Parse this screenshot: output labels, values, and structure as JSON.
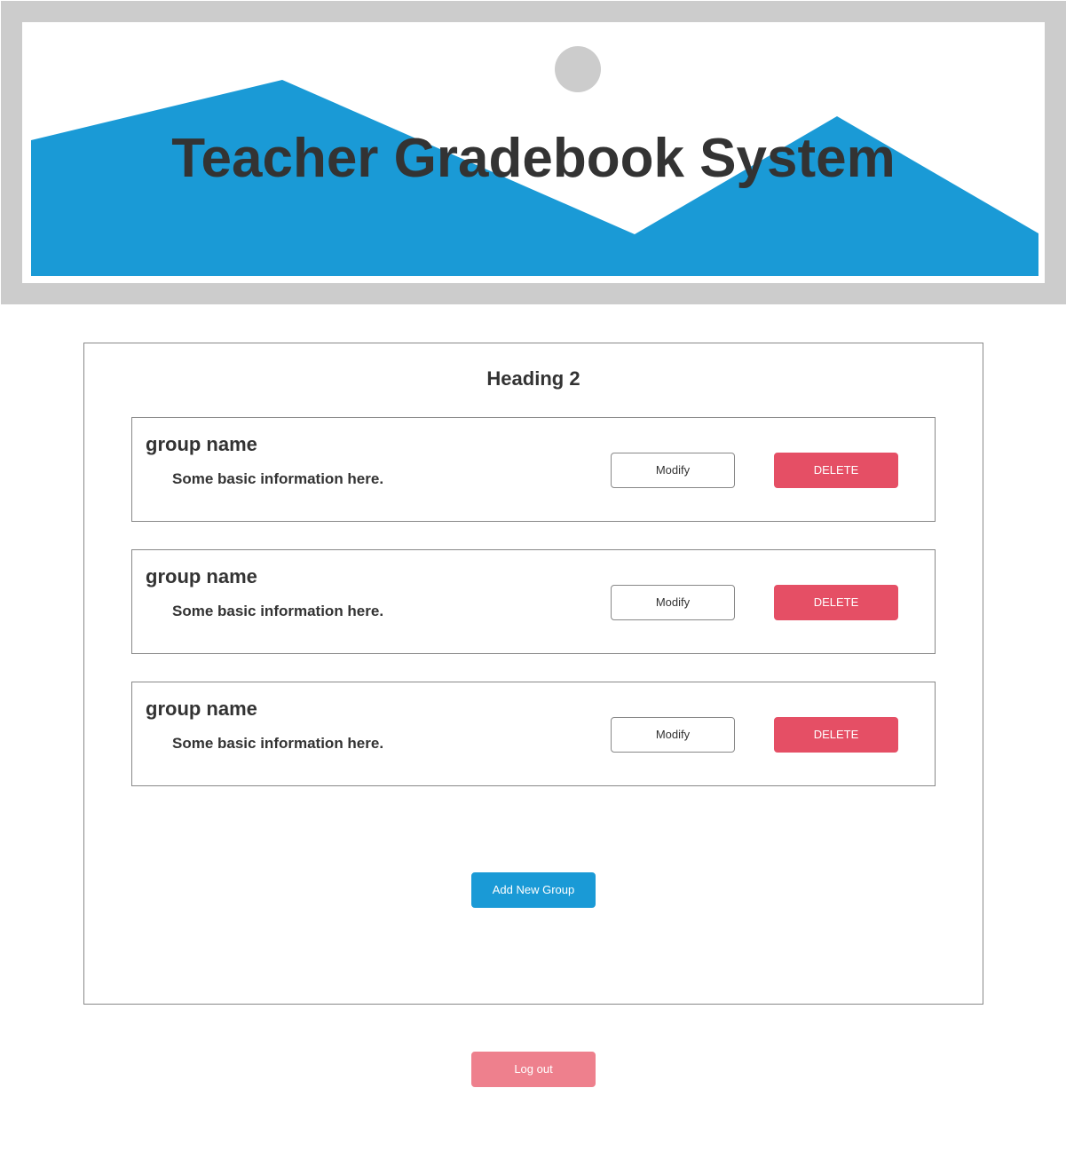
{
  "header": {
    "title": "Teacher Gradebook System",
    "image_placeholder": "landscape-placeholder-image",
    "colors": {
      "frame": "#cccccc",
      "mountains": "#1a9ad6",
      "sun": "#cccccc"
    }
  },
  "main": {
    "heading": "Heading 2",
    "groups": [
      {
        "name": "group name",
        "info": "Some basic information here.",
        "modify_label": "Modify",
        "delete_label": "DELETE"
      },
      {
        "name": "group name",
        "info": "Some basic information here.",
        "modify_label": "Modify",
        "delete_label": "DELETE"
      },
      {
        "name": "group name",
        "info": "Some basic information here.",
        "modify_label": "Modify",
        "delete_label": "DELETE"
      }
    ],
    "add_group_label": "Add New Group"
  },
  "footer": {
    "logout_label": "Log out"
  },
  "colors": {
    "primary": "#1a9ad6",
    "danger": "#e54f65",
    "danger_light": "#ee808d",
    "text": "#333333",
    "border": "#888888"
  }
}
